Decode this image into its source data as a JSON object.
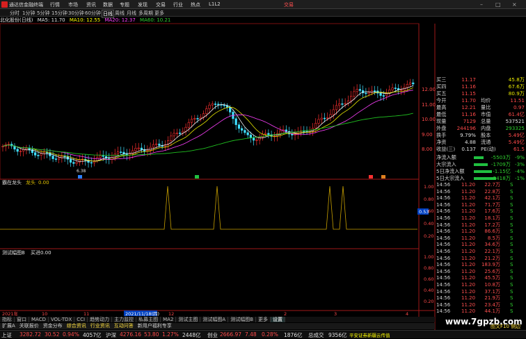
{
  "titlebar": {
    "app_title": "通达信金融终端",
    "menus": [
      "行情",
      "市场",
      "资讯",
      "数据",
      "专题",
      "发现",
      "交易",
      "行业",
      "热点",
      "L1L2"
    ],
    "trade_label": "交易"
  },
  "periods": [
    "分时",
    "1分钟",
    "5分钟",
    "15分钟",
    "30分钟",
    "60分钟",
    "日线",
    "周线",
    "月线",
    "多周期",
    "更多"
  ],
  "ma_bar": {
    "stock": "北化股份(日线)",
    "ma5": "MA5: 11.70",
    "ma10": "MA10: 12.55",
    "ma20": "MA20: 12.37",
    "ma60": "MA60: 10.21"
  },
  "price_axis": [
    "12.00",
    "11.00",
    "10.00",
    "9.00",
    "8.00"
  ],
  "low_label": "6.38",
  "ind1": {
    "title": "霸在龙头",
    "name": "龙头",
    "value": "0.00",
    "axis": [
      "1.00",
      "0.80",
      "0.60",
      "0.40",
      "0.20"
    ],
    "cur": "0.53"
  },
  "ind2": {
    "title": "测试幅图B",
    "name": "买进",
    "value": "0.00",
    "axis": [
      "1.00",
      "0.80",
      "0.60",
      "0.40",
      "0.20"
    ]
  },
  "date_axis": [
    "2021年",
    "10",
    "11",
    "2021/11/18(四)",
    "12",
    "2",
    "3",
    "4"
  ],
  "quote": [
    {
      "l": "买三",
      "m": "11.17",
      "n": "",
      "v": "45.8万"
    },
    {
      "l": "买四",
      "m": "11.16",
      "n": "",
      "v": "67.6万"
    },
    {
      "l": "买五",
      "m": "11.15",
      "n": "",
      "v": "80.9万"
    },
    {
      "l": "今开",
      "m": "11.70",
      "n": "均价",
      "v": "11.51"
    },
    {
      "l": "最高",
      "m": "12.21",
      "n": "量比",
      "v": "0.97"
    },
    {
      "l": "最低",
      "m": "11.16",
      "n": "市值",
      "v": "61.4亿"
    },
    {
      "l": "现量",
      "m": "7129",
      "n": "总量",
      "v": "537521"
    },
    {
      "l": "外盘",
      "m": "244196",
      "n": "内盘",
      "v": "293325"
    },
    {
      "l": "换手",
      "m": "9.79%",
      "n": "股本",
      "v": "5.49亿"
    },
    {
      "l": "净资",
      "m": "4.88",
      "n": "流通",
      "v": "5.49亿"
    },
    {
      "l": "收益(三)",
      "m": "0.137",
      "n": "PE(动)",
      "v": "61.5"
    }
  ],
  "flows": [
    {
      "l": "净流入额",
      "v": "-5503万",
      "p": "-9%"
    },
    {
      "l": "大宗流入",
      "v": "-1709万",
      "p": "-3%"
    },
    {
      "l": "5日净流入额",
      "v": "-1.15亿",
      "p": "-4%"
    },
    {
      "l": "5日大宗流入",
      "v": "-3418万",
      "p": "-1%"
    }
  ],
  "ticks": [
    {
      "t": "14:56",
      "p": "11.20",
      "v": "22.7万",
      "b": "S"
    },
    {
      "t": "14:56",
      "p": "11.20",
      "v": "22.8万",
      "b": "S"
    },
    {
      "t": "14:56",
      "p": "11.20",
      "v": "42.1万",
      "b": "S"
    },
    {
      "t": "14:56",
      "p": "11.20",
      "v": "71.7万",
      "b": "S"
    },
    {
      "t": "14:56",
      "p": "11.20",
      "v": "17.6万",
      "b": "S"
    },
    {
      "t": "14:56",
      "p": "11.20",
      "v": "18.1万",
      "b": "S"
    },
    {
      "t": "14:56",
      "p": "11.20",
      "v": "17.2万",
      "b": "S"
    },
    {
      "t": "14:56",
      "p": "11.20",
      "v": "86.6万",
      "b": "S"
    },
    {
      "t": "14:56",
      "p": "11.20",
      "v": "8.5万",
      "b": "S"
    },
    {
      "t": "14:56",
      "p": "11.20",
      "v": "34.6万",
      "b": "S"
    },
    {
      "t": "14:56",
      "p": "11.20",
      "v": "22.1万",
      "b": "S"
    },
    {
      "t": "14:56",
      "p": "11.20",
      "v": "21.2万",
      "b": "S"
    },
    {
      "t": "14:56",
      "p": "11.20",
      "v": "183.9万",
      "b": "S"
    },
    {
      "t": "14:56",
      "p": "11.20",
      "v": "25.6万",
      "b": "S"
    },
    {
      "t": "14:56",
      "p": "11.20",
      "v": "45.5万",
      "b": "S"
    },
    {
      "t": "14:56",
      "p": "11.20",
      "v": "10.8万",
      "b": "S"
    },
    {
      "t": "14:56",
      "p": "11.20",
      "v": "37.1万",
      "b": "S"
    },
    {
      "t": "14:56",
      "p": "11.20",
      "v": "21.9万",
      "b": "S"
    },
    {
      "t": "14:56",
      "p": "11.20",
      "v": "23.4万",
      "b": "S"
    },
    {
      "t": "14:56",
      "p": "11.20",
      "v": "44.1万",
      "b": "S"
    }
  ],
  "bottom_tabs": [
    "指标",
    "窗口",
    "MACD",
    "VOL-TDX",
    "CCI",
    "趋势动力",
    "主力监控",
    "私募主图",
    "MA2",
    "测试主图",
    "测试幅图A",
    "测试幅图B",
    "更多",
    "设置"
  ],
  "bottom_tabs2": [
    "扩展A",
    "关联报价",
    "资金分布",
    "综合资讯",
    "行业资讯",
    "互动问答",
    "新用户福利专享"
  ],
  "right_bottom": "图文F10 侧边",
  "statusbar": {
    "sh_label": "上证",
    "sh_val": "3282.72",
    "sh_chg": "30.52",
    "sh_pct": "0.94%",
    "sh_amt": "4057亿",
    "sz_label": "沪深",
    "sz_val": "4276.16",
    "sz_chg": "53.80",
    "sz_pct": "1.27%",
    "sz_amt": "2448亿",
    "cy_label": "创业",
    "cy_val": "2666.97",
    "cy_chg": "7.48",
    "cy_pct": "0.28%",
    "cy_amt": "1876亿",
    "total_label": "总成交",
    "total_amt": "9356亿",
    "msg": "平安证券新疆云传值"
  },
  "watermark": "www.7gpzb.com"
}
